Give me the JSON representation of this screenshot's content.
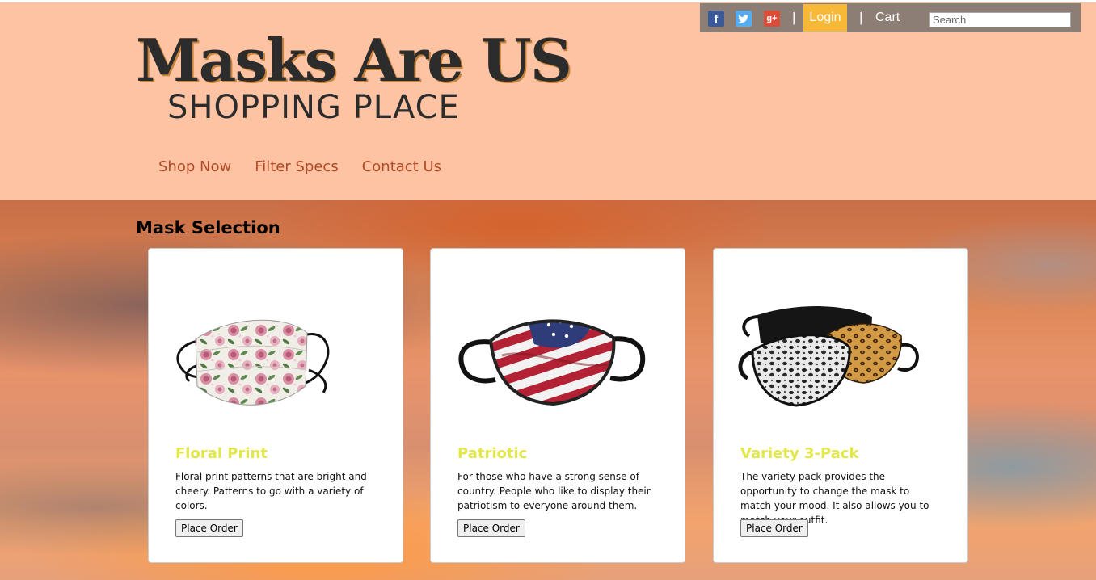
{
  "header": {
    "title": "Masks Are US",
    "subtitle": "SHOPPING PLACE",
    "nav": [
      {
        "label": "Shop Now"
      },
      {
        "label": "Filter Specs"
      },
      {
        "label": "Contact Us"
      }
    ]
  },
  "topbar": {
    "social": [
      {
        "icon": "facebook-icon",
        "glyph": "f",
        "color": "#3b5998"
      },
      {
        "icon": "twitter-icon",
        "glyph": "t",
        "color": "#55acee"
      },
      {
        "icon": "google-plus-icon",
        "glyph": "g+",
        "color": "#dd4b39"
      }
    ],
    "separator": "|",
    "login_label": "Login",
    "cart_label": "Cart",
    "search_placeholder": "Search",
    "login_color": "#f9b938",
    "bar_color": "#8c7e74"
  },
  "main": {
    "section_title": "Mask Selection",
    "products": [
      {
        "title": "Floral Print",
        "description": "Floral print patterns that are bright and cheery. Patterns to go with a variety of colors.",
        "button_label": "Place Order",
        "image": "floral-mask-image"
      },
      {
        "title": "Patriotic",
        "description": "For those who have a strong sense of country. People who like to display their patriotism to everyone around them.",
        "button_label": "Place Order",
        "image": "american-flag-mask-image"
      },
      {
        "title": "Variety 3-Pack",
        "description": "The variety pack provides the opportunity to change the mask to match your mood. It also allows you to match your outfit.",
        "button_label": "Place Order",
        "image": "leopard-variety-mask-image"
      }
    ]
  },
  "colors": {
    "header_bg": "#fec3a2",
    "nav_link": "#b24a25",
    "product_title": "#e2e84a"
  }
}
